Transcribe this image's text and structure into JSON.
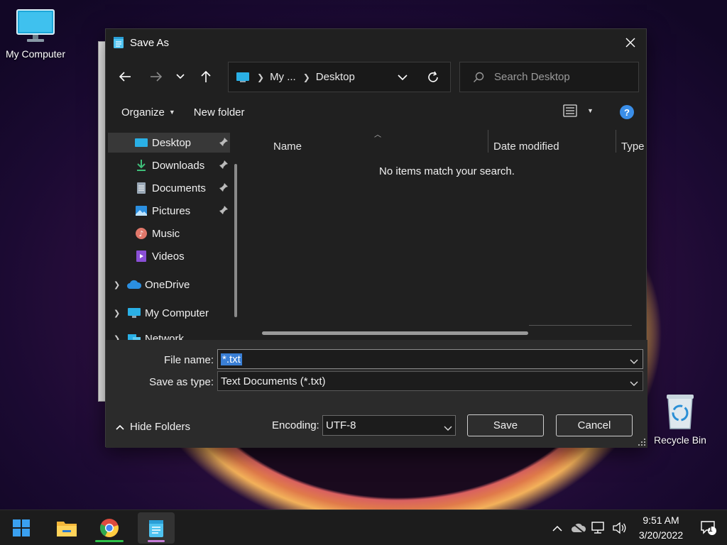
{
  "desktop": {
    "icons": [
      {
        "label": "My Computer",
        "icon": "monitor-icon"
      },
      {
        "label": "Recycle Bin",
        "icon": "recycle-bin-icon"
      }
    ]
  },
  "dialog": {
    "title": "Save As",
    "address": {
      "crumbs": [
        "My ...",
        "Desktop"
      ]
    },
    "search": {
      "placeholder": "Search Desktop"
    },
    "toolbar": {
      "organize": "Organize",
      "new_folder": "New folder"
    },
    "nav_items": [
      {
        "label": "Desktop",
        "icon": "desktop-icon",
        "pinned": true,
        "selected": true
      },
      {
        "label": "Downloads",
        "icon": "download-icon",
        "pinned": true
      },
      {
        "label": "Documents",
        "icon": "document-icon",
        "pinned": true
      },
      {
        "label": "Pictures",
        "icon": "pictures-icon",
        "pinned": true
      },
      {
        "label": "Music",
        "icon": "music-icon"
      },
      {
        "label": "Videos",
        "icon": "videos-icon"
      },
      {
        "label": "OneDrive",
        "icon": "cloud-icon"
      },
      {
        "label": "My Computer",
        "icon": "monitor-icon"
      },
      {
        "label": "Network",
        "icon": "network-icon"
      }
    ],
    "columns": [
      "Name",
      "Date modified",
      "Type"
    ],
    "empty_message": "No items match your search.",
    "file_name": {
      "label": "File name:",
      "value": "*.txt"
    },
    "save_as_type": {
      "label": "Save as type:",
      "value": "Text Documents (*.txt)"
    },
    "hide_folders": "Hide Folders",
    "encoding": {
      "label": "Encoding:",
      "value": "UTF-8"
    },
    "save_button": "Save",
    "cancel_button": "Cancel"
  },
  "taskbar": {
    "apps": [
      "start-icon",
      "file-explorer-icon",
      "chrome-icon",
      "notepad-icon"
    ],
    "time": "9:51 AM",
    "date": "3/20/2022",
    "notification_count": "1",
    "colors": {
      "chrome_indicator": "#2ec24a",
      "notepad_indicator": "#c77dd8",
      "accent": "#3a7fd5"
    }
  }
}
